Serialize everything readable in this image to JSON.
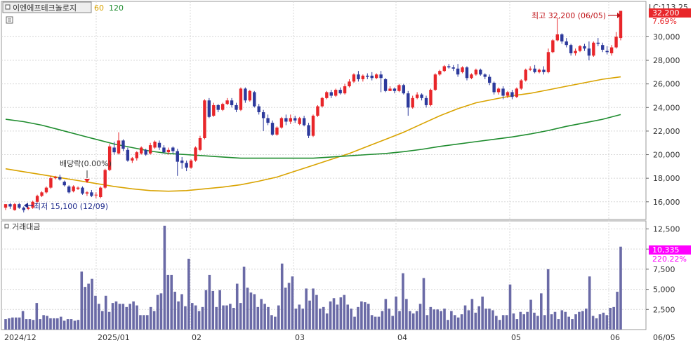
{
  "legend": {
    "title": "이엔에프테크놀로지",
    "ma1": "60",
    "ma2": "120",
    "ma1_color": "#d9a300",
    "ma2_color": "#1e8c2e"
  },
  "volume_panel": {
    "title": "거래대금"
  },
  "annotations": {
    "high": "최고 32,200 (06/05)",
    "low": "최저 15,100 (12/09)",
    "dividend": "배당락(0.00%)"
  },
  "right_axis": {
    "lc": "LC:113.25",
    "last_price": "32,200",
    "last_change": "7.69%",
    "last_volume": "10,335",
    "volume_change": "220.22%",
    "price_ticks": [
      "30,000",
      "28,000",
      "26,000",
      "24,000",
      "22,000",
      "20,000",
      "18,000",
      "16,000"
    ],
    "volume_ticks": [
      "12,500",
      "10,000",
      "7,500",
      "5,000",
      "2,500"
    ]
  },
  "x_labels": [
    "2024/12",
    "2025/01",
    "02",
    "03",
    "04",
    "05",
    "06",
    "06/05"
  ],
  "colors": {
    "up": "#e8262a",
    "down": "#2d3a9c",
    "volume": "#6a6aa6",
    "price_box": "#e8262a",
    "volume_box": "#ff00ff"
  },
  "chart_data": {
    "type": "candlestick",
    "price_range": [
      14500,
      33000
    ],
    "volume_range": [
      0,
      13500
    ],
    "moving_averages": [
      {
        "name": "60",
        "values": [
          18800,
          18550,
          18300,
          18050,
          17800,
          17550,
          17300,
          17100,
          16950,
          16900,
          16950,
          17100,
          17250,
          17450,
          17750,
          18100,
          18600,
          19100,
          19600,
          20100,
          20700,
          21300,
          21900,
          22600,
          23300,
          23900,
          24400,
          24700,
          25000,
          25200,
          25500,
          25800,
          26100,
          26400,
          26600
        ]
      },
      {
        "name": "120",
        "values": [
          23000,
          22800,
          22500,
          22100,
          21700,
          21300,
          20900,
          20600,
          20300,
          20100,
          20000,
          19900,
          19800,
          19700,
          19700,
          19700,
          19700,
          19700,
          19800,
          19900,
          20000,
          20100,
          20250,
          20450,
          20700,
          20900,
          21100,
          21300,
          21500,
          21750,
          22050,
          22400,
          22700,
          23000,
          23400
        ]
      }
    ],
    "candles": [
      [
        15500,
        15800,
        15800,
        15300
      ],
      [
        15800,
        15600,
        15900,
        15400
      ],
      [
        15300,
        15800,
        15900,
        15250
      ],
      [
        15800,
        15500,
        15900,
        15400
      ],
      [
        15500,
        15300,
        15600,
        15100
      ],
      [
        15400,
        15500,
        15600,
        15300
      ],
      [
        15500,
        16000,
        16100,
        15400
      ],
      [
        16000,
        16500,
        16600,
        15900
      ],
      [
        16500,
        16800,
        16900,
        16400
      ],
      [
        16800,
        17200,
        17300,
        16700
      ],
      [
        17200,
        18000,
        18200,
        17100
      ],
      [
        18000,
        18100,
        18200,
        17900
      ],
      [
        18100,
        17900,
        18300,
        17800
      ],
      [
        17700,
        17400,
        17800,
        17300
      ],
      [
        17300,
        16800,
        17400,
        16700
      ],
      [
        16900,
        17300,
        17400,
        16800
      ],
      [
        17100,
        17200,
        17300,
        17000
      ],
      [
        17200,
        16700,
        17300,
        16600
      ],
      [
        16700,
        16800,
        16900,
        16500
      ],
      [
        16800,
        16500,
        17000,
        16400
      ],
      [
        16600,
        16600,
        16800,
        16300
      ],
      [
        16400,
        17200,
        17300,
        16300
      ],
      [
        17200,
        18700,
        18800,
        17100
      ],
      [
        18700,
        20700,
        20900,
        18600
      ],
      [
        20600,
        20200,
        21100,
        20000
      ],
      [
        20100,
        21200,
        21900,
        20000
      ],
      [
        21200,
        20500,
        21300,
        20300
      ],
      [
        20400,
        19500,
        20600,
        19400
      ],
      [
        19500,
        19700,
        19800,
        19300
      ],
      [
        19700,
        20200,
        20300,
        19500
      ],
      [
        20100,
        20600,
        20700,
        20000
      ],
      [
        20400,
        20000,
        20500,
        19900
      ],
      [
        20100,
        20800,
        21000,
        20000
      ],
      [
        20600,
        21100,
        21200,
        20500
      ],
      [
        21000,
        20600,
        21200,
        20400
      ],
      [
        20600,
        20200,
        20800,
        20100
      ],
      [
        20200,
        20400,
        20600,
        20000
      ],
      [
        20600,
        20300,
        20700,
        20100
      ],
      [
        20300,
        19400,
        20500,
        18200
      ],
      [
        19500,
        19300,
        19800,
        18800
      ],
      [
        19300,
        18900,
        19500,
        18600
      ],
      [
        18900,
        19500,
        19600,
        18800
      ],
      [
        19500,
        20600,
        20700,
        19400
      ],
      [
        20400,
        21400,
        21600,
        20300
      ],
      [
        21400,
        24600,
        24700,
        21300
      ],
      [
        24600,
        23200,
        24800,
        23100
      ],
      [
        23300,
        24200,
        24400,
        23200
      ],
      [
        24200,
        23800,
        24300,
        23600
      ],
      [
        23800,
        24300,
        24400,
        23700
      ],
      [
        24300,
        24600,
        24800,
        24200
      ],
      [
        24600,
        24200,
        24800,
        24000
      ],
      [
        24200,
        23800,
        24400,
        23600
      ],
      [
        23800,
        25600,
        25700,
        23700
      ],
      [
        25600,
        24600,
        25700,
        24400
      ],
      [
        24600,
        25400,
        25500,
        24500
      ],
      [
        25300,
        24100,
        25400,
        24000
      ],
      [
        24100,
        23600,
        24300,
        23400
      ],
      [
        23600,
        23100,
        23800,
        22000
      ],
      [
        23100,
        22700,
        23400,
        22500
      ],
      [
        22700,
        21700,
        22900,
        21600
      ],
      [
        21700,
        22300,
        22400,
        21600
      ],
      [
        22300,
        23100,
        23200,
        22200
      ],
      [
        23100,
        22800,
        23400,
        22500
      ],
      [
        22800,
        23100,
        23400,
        22600
      ],
      [
        23100,
        22900,
        23300,
        22700
      ],
      [
        22600,
        23100,
        23200,
        22500
      ],
      [
        23100,
        22500,
        23300,
        22400
      ],
      [
        22500,
        21600,
        22700,
        21400
      ],
      [
        21600,
        23300,
        23400,
        21500
      ],
      [
        23300,
        24100,
        24200,
        23200
      ],
      [
        24100,
        24800,
        24900,
        24000
      ],
      [
        24800,
        25300,
        25400,
        24700
      ],
      [
        25300,
        25000,
        25500,
        24800
      ],
      [
        25000,
        25500,
        25600,
        24900
      ],
      [
        25500,
        25200,
        25700,
        25100
      ],
      [
        25200,
        25800,
        26000,
        25100
      ],
      [
        25800,
        26200,
        26400,
        25700
      ],
      [
        26200,
        26800,
        26900,
        26100
      ],
      [
        26800,
        26400,
        27100,
        26200
      ],
      [
        26400,
        26700,
        26800,
        26200
      ],
      [
        26700,
        26600,
        26900,
        26400
      ],
      [
        26700,
        26500,
        27000,
        26300
      ],
      [
        26500,
        26800,
        26900,
        26400
      ],
      [
        26800,
        26500,
        27100,
        25300
      ],
      [
        26400,
        25400,
        26500,
        25300
      ],
      [
        25400,
        25600,
        25800,
        25400
      ],
      [
        25600,
        25400,
        25700,
        25200
      ],
      [
        25400,
        25900,
        26000,
        25300
      ],
      [
        25900,
        25200,
        26000,
        25100
      ],
      [
        25200,
        24000,
        25400,
        23300
      ],
      [
        24000,
        24800,
        25000,
        23900
      ],
      [
        24800,
        25100,
        25300,
        24700
      ],
      [
        25100,
        24800,
        25200,
        24600
      ],
      [
        24800,
        24200,
        25000,
        24000
      ],
      [
        24200,
        25500,
        25600,
        24100
      ],
      [
        25500,
        26800,
        26900,
        25400
      ],
      [
        26800,
        27100,
        27200,
        26700
      ],
      [
        27100,
        27500,
        27600,
        27000
      ],
      [
        27500,
        27400,
        27700,
        27300
      ],
      [
        27400,
        27300,
        27600,
        27100
      ],
      [
        27300,
        26800,
        27700,
        26600
      ],
      [
        27000,
        27400,
        27500,
        26900
      ],
      [
        27400,
        26500,
        27500,
        26300
      ],
      [
        26500,
        26800,
        26900,
        26400
      ],
      [
        26800,
        27200,
        27300,
        26700
      ],
      [
        27200,
        26800,
        27300,
        26700
      ],
      [
        26800,
        26600,
        26900,
        26400
      ],
      [
        26600,
        26100,
        26800,
        25900
      ],
      [
        26100,
        25300,
        26200,
        25100
      ],
      [
        25300,
        25600,
        25700,
        25100
      ],
      [
        25600,
        25000,
        25800,
        24700
      ],
      [
        25000,
        25300,
        25400,
        24800
      ],
      [
        25300,
        24900,
        25500,
        24700
      ],
      [
        24900,
        25600,
        25700,
        24800
      ],
      [
        25600,
        26300,
        26400,
        25500
      ],
      [
        26300,
        27200,
        27300,
        26200
      ],
      [
        27200,
        27300,
        27500,
        27100
      ],
      [
        27300,
        27000,
        27600,
        26900
      ],
      [
        27000,
        27200,
        27300,
        26900
      ],
      [
        27200,
        27000,
        27500,
        26800
      ],
      [
        27000,
        28700,
        29000,
        26900
      ],
      [
        28700,
        29700,
        29800,
        28600
      ],
      [
        29700,
        30200,
        31600,
        29600
      ],
      [
        30200,
        29600,
        30300,
        29400
      ],
      [
        29600,
        29300,
        29900,
        29100
      ],
      [
        29300,
        28600,
        29400,
        28400
      ],
      [
        28600,
        28800,
        29000,
        28400
      ],
      [
        28800,
        29200,
        29300,
        28700
      ],
      [
        29200,
        29000,
        29400,
        28800
      ],
      [
        29000,
        28400,
        29600,
        28000
      ],
      [
        28400,
        29500,
        29600,
        28300
      ],
      [
        29500,
        29400,
        29900,
        29200
      ],
      [
        29300,
        28900,
        29500,
        28700
      ],
      [
        28800,
        28700,
        29200,
        28500
      ],
      [
        28600,
        29100,
        29300,
        28400
      ],
      [
        29100,
        30000,
        30400,
        29000
      ],
      [
        29900,
        32200,
        32200,
        29700
      ]
    ],
    "volume": [
      1300,
      1400,
      1500,
      1500,
      1500,
      2300,
      1300,
      1300,
      1200,
      3300,
      1300,
      1800,
      1700,
      1400,
      1400,
      1400,
      1600,
      1100,
      1300,
      1300,
      1100,
      1200,
      7200,
      5300,
      5700,
      6300,
      4200,
      3200,
      2300,
      4200,
      2200,
      3300,
      3500,
      3200,
      3200,
      2800,
      3200,
      3500,
      3000,
      1800,
      1800,
      1800,
      2800,
      2300,
      4300,
      4500,
      12900,
      6800,
      6800,
      4700,
      3500,
      4400,
      2900,
      8800,
      3300,
      3000,
      2300,
      2800,
      4900,
      6800,
      4800,
      2800,
      4900,
      3000,
      3000,
      3200,
      2700,
      5700,
      3300,
      7800,
      5200,
      4600,
      4400,
      2800,
      3800,
      3200,
      2800,
      1800,
      1600,
      3000,
      8200,
      5200,
      5800,
      6600,
      2600,
      3100,
      2600,
      5100,
      3600,
      5100,
      4300,
      2600,
      2800,
      2000,
      3500,
      3900,
      3100,
      4000,
      4300,
      3100,
      2600,
      1600,
      2800,
      3500,
      3400,
      3200,
      1800,
      1600,
      1600,
      2300,
      3800,
      2600,
      1700,
      4100,
      2300,
      7000,
      3800,
      2300,
      2000,
      2300,
      3200,
      6400,
      1800,
      2800,
      2500,
      2500,
      2300,
      2600,
      1200,
      2300,
      1800,
      1500,
      1900,
      3000,
      2400,
      3800,
      2100,
      2900,
      4100,
      2600,
      2600,
      2400,
      1700,
      1200,
      1800,
      1800,
      5600,
      2000,
      1300,
      2200,
      1900,
      2200,
      3700,
      2100,
      1700,
      4500,
      1800,
      7500,
      1900,
      2200,
      1300,
      2400,
      2200,
      1600,
      1300,
      1900,
      2200,
      2300,
      2600,
      6600,
      1700,
      1400,
      1900,
      2100,
      1800,
      2700,
      2800,
      4700,
      10300
    ]
  }
}
